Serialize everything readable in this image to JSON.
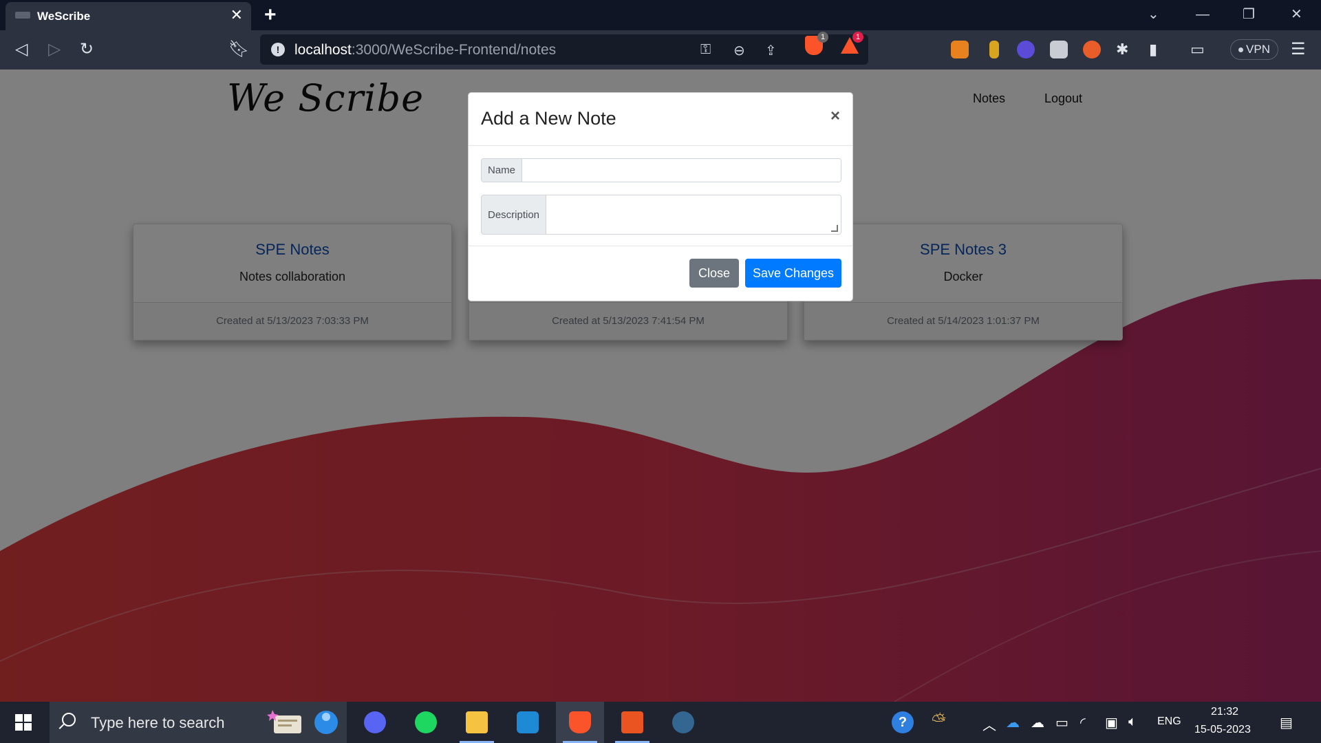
{
  "browser": {
    "tab_title": "WeScribe",
    "tab_close": "✕",
    "new_tab": "+",
    "url_host": "localhost",
    "url_rest": ":3000/WeScribe-Frontend/notes",
    "shield_badge": "1",
    "alert_badge": "1",
    "vpn_label": "VPN"
  },
  "site": {
    "logo": "We Scribe",
    "nav": {
      "notes": "Notes",
      "logout": "Logout"
    }
  },
  "cards": [
    {
      "title": "SPE Notes",
      "description": "Notes collaboration",
      "created": "Created at 5/13/2023 7:03:33 PM"
    },
    {
      "title": "",
      "description": "",
      "created": "Created at 5/13/2023 7:41:54 PM"
    },
    {
      "title": "SPE Notes 3",
      "description": "Docker",
      "created": "Created at 5/14/2023 1:01:37 PM"
    }
  ],
  "modal": {
    "title": "Add a New Note",
    "close_x": "×",
    "name_label": "Name",
    "name_value": "",
    "description_label": "Description",
    "description_value": "",
    "close_button": "Close",
    "save_button": "Save Changes"
  },
  "taskbar": {
    "search_placeholder": "Type here to search",
    "language": "ENG",
    "time": "21:32",
    "date": "15-05-2023"
  },
  "colors": {
    "primary": "#007bff",
    "secondary": "#6c757d",
    "link": "#0d4db3",
    "wave_red": "#d8364e",
    "wave_magenta": "#b02a6a"
  }
}
